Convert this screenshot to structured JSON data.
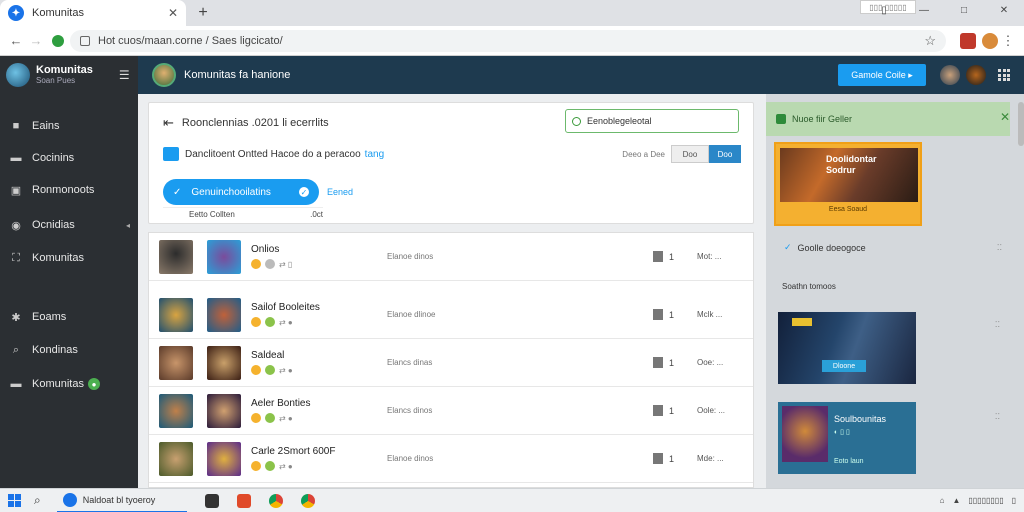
{
  "browser": {
    "tab_title": "Komunitas",
    "tab_close": "✕",
    "new_tab": "+",
    "window_field": "▯▯▯ ▯▯▯▯▯",
    "window_controls": [
      "▯",
      "—",
      "□",
      "✕"
    ],
    "url": "Hot cuos/maan.corne / Saes ligcicato/"
  },
  "app": {
    "brand_name": "Komunitas",
    "brand_sub": "Soan Pues",
    "header_title": "Komunitas fa hanione",
    "header_button": "Gamole Coile ▸"
  },
  "sidebar": {
    "items": [
      {
        "label": "Eains",
        "icon": "■"
      },
      {
        "label": "Cocinins",
        "icon": "▬"
      },
      {
        "label": "Ronmonoots",
        "icon": "▣"
      },
      {
        "label": "Ocnidias",
        "icon": "◉"
      },
      {
        "label": "Komunitas",
        "icon": "⛶"
      },
      {
        "label": "Eoams",
        "icon": "✱"
      },
      {
        "label": "Kondinas",
        "icon": "⌕"
      },
      {
        "label": "Komunitas",
        "icon": "▬",
        "badge": "●"
      }
    ],
    "arrow": "◂"
  },
  "topcard": {
    "back_icon": "⇤",
    "title": "Roonclennias  .0201 li ecerrlits",
    "search_placeholder": "Eenoblegeleotal",
    "desc": "Danclitoent Ontted Hacoe do a peracoo",
    "desc_link": "tang",
    "sort_label": "Deeo a Dee",
    "sort_value": "Doo",
    "sort_button": "Doo",
    "pill_check": "✓",
    "pill_label": "Genuinchooilatins",
    "pill_dot": "✓",
    "pill_link": "Eened",
    "row3_a": "Eetto Collten",
    "row3_b": ".0ct"
  },
  "rows": [
    {
      "name": "Onlios",
      "meta": "Elanoe dinos",
      "count": "1",
      "status": "Mot: ...",
      "c1": "#f5b22e",
      "c2": "#bbb",
      "sym": "⇄ ▯"
    },
    {
      "name": "Sailof Booleites",
      "meta": "Elanoe dlinoe",
      "count": "1",
      "status": "Mclk ...",
      "c1": "#f5b22e",
      "c2": "#8bc34a",
      "sym": "⇄ ●"
    },
    {
      "name": "Saldeal",
      "meta": "Elancs dinas",
      "count": "1",
      "status": "Ooe: ...",
      "c1": "#f5b22e",
      "c2": "#8bc34a",
      "sym": "⇄ ●"
    },
    {
      "name": "Aeler Bonties",
      "meta": "Elancs dinos",
      "count": "1",
      "status": "Oole: ...",
      "c1": "#f5b22e",
      "c2": "#8bc34a",
      "sym": "⇄ ●"
    },
    {
      "name": "Carle 2Smort 600F",
      "meta": "Elanoe dinos",
      "count": "1",
      "status": "Mde: ...",
      "c1": "#f5b22e",
      "c2": "#8bc34a",
      "sym": "⇄ ●"
    }
  ],
  "rpanel": {
    "header": "Nuoe fiir Geller",
    "close": "✕",
    "promo_title": "Doolidontar Sodrur",
    "promo_link": "Eesa Soaud",
    "item_check": "✓",
    "item": "Goolle doeogoce",
    "item_dots": "⁚⁚",
    "section": "Soathn tomoos",
    "cardA_button": "Dloone",
    "cardB_title": "Soulbounitas",
    "cardB_icons": "◐ ▯ ▯",
    "cardB_link": "Eoto laun"
  },
  "taskbar": {
    "search": "⌕",
    "app_label": "Naldoat bl tyoeroy",
    "tray": [
      "⌂",
      "▲",
      "▯▯▯▯▯▯▯▯",
      "▯"
    ]
  }
}
